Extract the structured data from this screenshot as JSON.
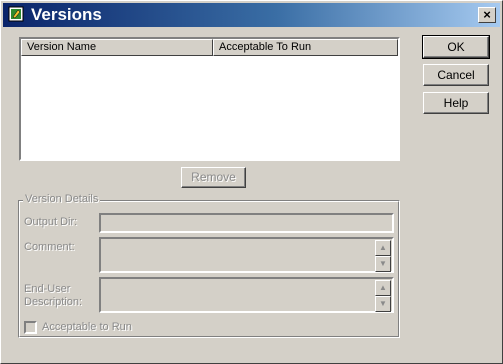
{
  "window": {
    "title": "Versions",
    "close_glyph": "×"
  },
  "list": {
    "columns": [
      "Version Name",
      "Acceptable To Run"
    ],
    "rows": []
  },
  "buttons": {
    "ok": "OK",
    "cancel": "Cancel",
    "help": "Help",
    "remove": "Remove"
  },
  "details": {
    "legend": "Version Details",
    "output_dir_label": "Output Dir:",
    "output_dir_value": "",
    "comment_label": "Comment:",
    "comment_value": "",
    "description_label_line1": "End-User",
    "description_label_line2": "Description:",
    "description_value": "",
    "acceptable_label": "Acceptable to Run",
    "acceptable_checked": false
  },
  "icons": {
    "app": "app-icon",
    "close": "close-icon",
    "up": "spin-up-icon",
    "down": "spin-down-icon"
  }
}
